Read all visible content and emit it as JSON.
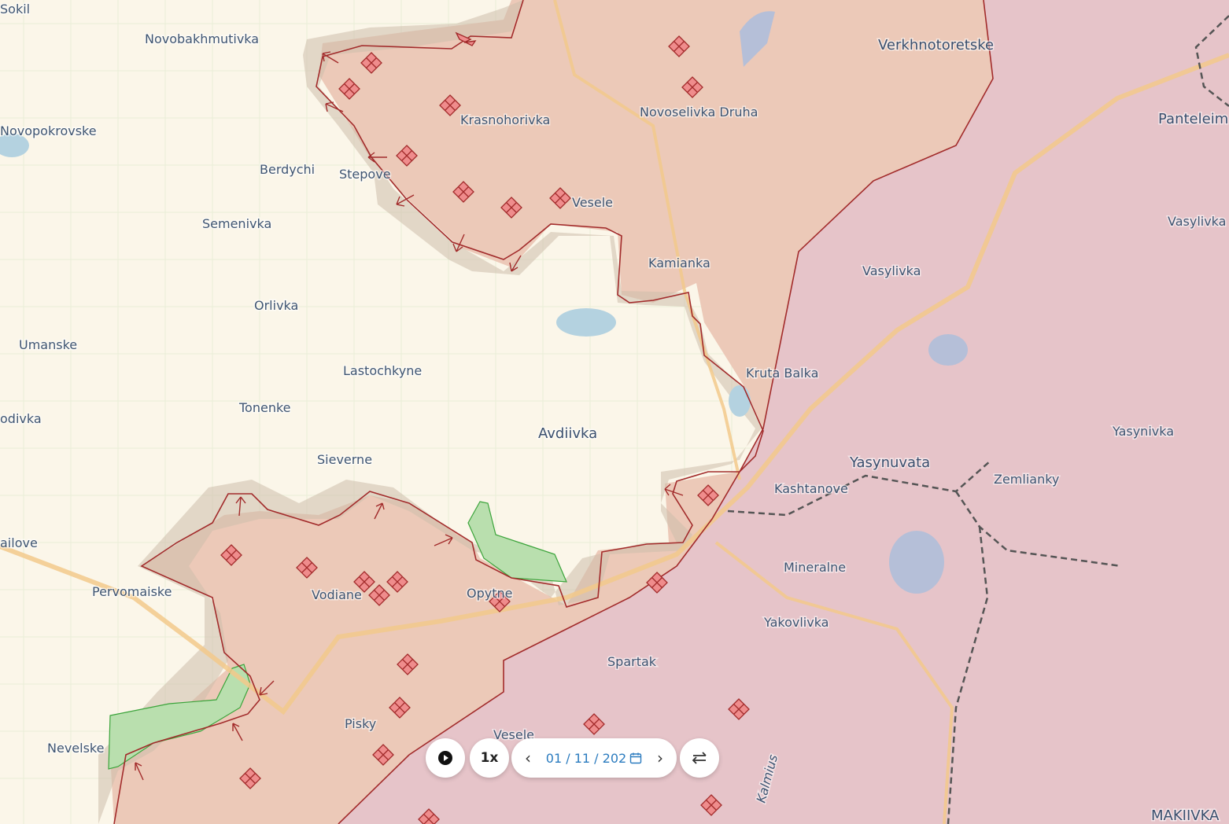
{
  "colors": {
    "land": "#fbf6e9",
    "occupied": "#e9c7b6",
    "occupied_deep": "#e3c3c8",
    "frontline": "#b02a2a",
    "contested": "rgba(210,196,180,0.75)",
    "liberated": "#b9dfae",
    "label": "#3f5572",
    "date_text": "#2a7bbf"
  },
  "labels": [
    {
      "id": "sokil",
      "text": "Sokil"
    },
    {
      "id": "novobakhmutivka",
      "text": "Novobakhmutivka"
    },
    {
      "id": "novopokrovske",
      "text": "Novopokrovske"
    },
    {
      "id": "berdychi",
      "text": "Berdychi"
    },
    {
      "id": "stepove",
      "text": "Stepove"
    },
    {
      "id": "semenivka",
      "text": "Semenivka"
    },
    {
      "id": "orlivka",
      "text": "Orlivka"
    },
    {
      "id": "umanske",
      "text": "Umanske"
    },
    {
      "id": "lastochkyne",
      "text": "Lastochkyne"
    },
    {
      "id": "tonenke",
      "text": "Tonenke"
    },
    {
      "id": "odivka",
      "text": "odivka"
    },
    {
      "id": "sieverne",
      "text": "Sieverne"
    },
    {
      "id": "avdiivka",
      "text": "Avdiivka"
    },
    {
      "id": "ailove",
      "text": "ailove"
    },
    {
      "id": "pervomaiske",
      "text": "Pervomaiske"
    },
    {
      "id": "vodiane",
      "text": "Vodiane"
    },
    {
      "id": "opytne",
      "text": "Opytne"
    },
    {
      "id": "nevelske",
      "text": "Nevelske"
    },
    {
      "id": "pisky",
      "text": "Pisky"
    },
    {
      "id": "vesele_s",
      "text": "Vesele"
    },
    {
      "id": "spartak",
      "text": "Spartak"
    },
    {
      "id": "yakovlivka",
      "text": "Yakovlivka"
    },
    {
      "id": "mineralne",
      "text": "Mineralne"
    },
    {
      "id": "kashtanove",
      "text": "Kashtanove"
    },
    {
      "id": "yasynuvata",
      "text": "Yasynuvata"
    },
    {
      "id": "zemlianky",
      "text": "Zemlianky"
    },
    {
      "id": "yasynivka",
      "text": "Yasynivka"
    },
    {
      "id": "kruta_balka",
      "text": "Kruta Balka"
    },
    {
      "id": "kamianka",
      "text": "Kamianka"
    },
    {
      "id": "vesele_n",
      "text": "Vesele"
    },
    {
      "id": "krasnohorivka",
      "text": "Krasnohorivka"
    },
    {
      "id": "novoselivka_druha",
      "text": "Novoselivka Druha"
    },
    {
      "id": "verkhnotoretske",
      "text": "Verkhnotoretske"
    },
    {
      "id": "panteleimonivka",
      "text": "Panteleim"
    },
    {
      "id": "vasylivka_e",
      "text": "Vasylivka"
    },
    {
      "id": "vasylivka_c",
      "text": "Vasylivka"
    },
    {
      "id": "makiivka",
      "text": "MAKIIVKA"
    },
    {
      "id": "kalmius",
      "text": "Kalmius"
    }
  ],
  "controls": {
    "play_icon": "play-icon",
    "speed_label": "1x",
    "date_value": "01 / 11 / 202",
    "calendar_icon": "calendar-icon",
    "prev_icon": "chevron-left-icon",
    "next_icon": "chevron-right-icon",
    "swap_icon": "swap-icon"
  }
}
